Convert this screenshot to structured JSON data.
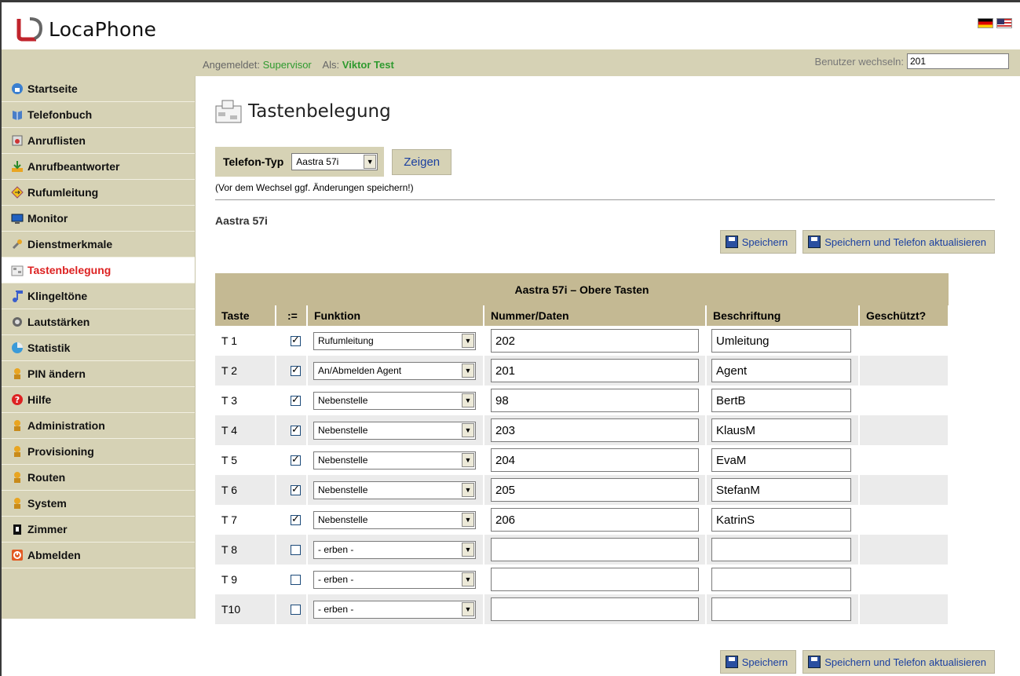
{
  "app": {
    "logo_text": "LocaPhone"
  },
  "info": {
    "logged_in_label": "Angemeldet:",
    "logged_in_user": "Supervisor",
    "as_label": "Als:",
    "as_user": "Viktor Test",
    "switch_user_label": "Benutzer wechseln:",
    "switch_user_value": "201"
  },
  "sidebar": {
    "items": [
      {
        "label": "Startseite",
        "icon": "home-icon"
      },
      {
        "label": "Telefonbuch",
        "icon": "book-icon"
      },
      {
        "label": "Anruflisten",
        "icon": "call-list-icon"
      },
      {
        "label": "Anrufbeantworter",
        "icon": "voicemail-icon"
      },
      {
        "label": "Rufumleitung",
        "icon": "forward-icon"
      },
      {
        "label": "Monitor",
        "icon": "monitor-icon"
      },
      {
        "label": "Dienstmerkmale",
        "icon": "wrench-icon"
      },
      {
        "label": "Tastenbelegung",
        "icon": "keypad-icon",
        "active": true
      },
      {
        "label": "Klingeltöne",
        "icon": "music-note-icon"
      },
      {
        "label": "Lautstärken",
        "icon": "speaker-icon"
      },
      {
        "label": "Statistik",
        "icon": "chart-icon"
      },
      {
        "label": "PIN ändern",
        "icon": "user-key-icon"
      },
      {
        "label": "Hilfe",
        "icon": "help-icon"
      },
      {
        "label": "Administration",
        "icon": "admin-icon"
      },
      {
        "label": "Provisioning",
        "icon": "admin-icon"
      },
      {
        "label": "Routen",
        "icon": "admin-icon"
      },
      {
        "label": "System",
        "icon": "admin-icon"
      },
      {
        "label": "Zimmer",
        "icon": "room-icon"
      },
      {
        "label": "Abmelden",
        "icon": "logout-icon"
      }
    ]
  },
  "page": {
    "title": "Tastenbelegung",
    "phone_type_label": "Telefon-Typ",
    "phone_type_value": "Aastra 57i",
    "show_button": "Zeigen",
    "hint": "(Vor dem Wechsel ggf. Änderungen speichern!)",
    "model_label": "Aastra 57i",
    "save_button": "Speichern",
    "save_update_button": "Speichern und Telefon aktualisieren"
  },
  "table": {
    "caption": "Aastra 57i – Obere Tasten",
    "headers": [
      "Taste",
      ":=",
      "Funktion",
      "Nummer/Daten",
      "Beschriftung",
      "Geschützt?"
    ],
    "rows": [
      {
        "key": "T 1",
        "checked": true,
        "function": "Rufumleitung",
        "number": "202",
        "label": "Umleitung"
      },
      {
        "key": "T 2",
        "checked": true,
        "function": "An/Abmelden Agent",
        "number": "201",
        "label": "Agent"
      },
      {
        "key": "T 3",
        "checked": true,
        "function": "Nebenstelle",
        "number": "98",
        "label": "BertB"
      },
      {
        "key": "T 4",
        "checked": true,
        "function": "Nebenstelle",
        "number": "203",
        "label": "KlausM"
      },
      {
        "key": "T 5",
        "checked": true,
        "function": "Nebenstelle",
        "number": "204",
        "label": "EvaM"
      },
      {
        "key": "T 6",
        "checked": true,
        "function": "Nebenstelle",
        "number": "205",
        "label": "StefanM"
      },
      {
        "key": "T 7",
        "checked": true,
        "function": "Nebenstelle",
        "number": "206",
        "label": "KatrinS"
      },
      {
        "key": "T 8",
        "checked": false,
        "function": "- erben -",
        "number": "",
        "label": ""
      },
      {
        "key": "T 9",
        "checked": false,
        "function": "- erben -",
        "number": "",
        "label": ""
      },
      {
        "key": "T10",
        "checked": false,
        "function": "- erben -",
        "number": "",
        "label": ""
      }
    ]
  }
}
